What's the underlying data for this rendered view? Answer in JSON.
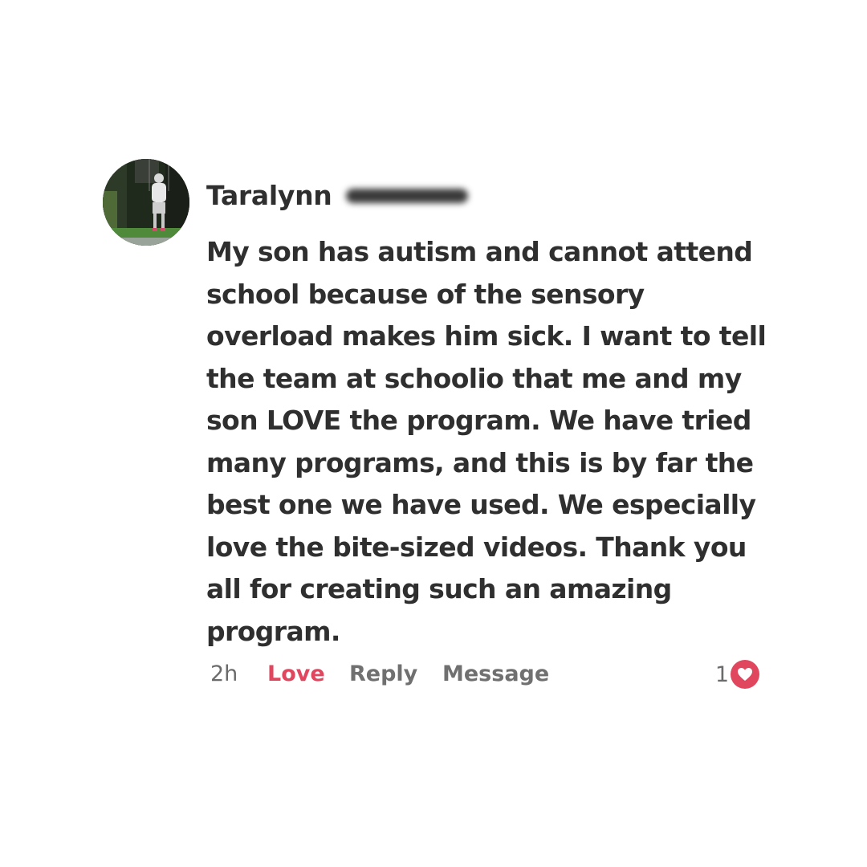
{
  "comment": {
    "author": {
      "name": "Taralynn",
      "avatar": "profile-photo-child-on-swing"
    },
    "text_lines": [
      "My son has autism and cannot attend",
      "school because of the sensory",
      "overload makes him sick. I want to tell",
      "the team at schoolio that me and my",
      "son LOVE the program. We have tried",
      "many programs, and this is by far the",
      "best one we have used. We especially",
      "love the bite-sized videos. Thank you",
      "all for creating such an amazing",
      "program."
    ],
    "actions": {
      "timestamp": "2h",
      "love_label": "Love",
      "reply_label": "Reply",
      "message_label": "Message"
    },
    "reactions": {
      "count": "1",
      "icon": "heart-icon"
    }
  },
  "colors": {
    "text": "#2f2f2f",
    "love_active": "#e0475f",
    "action_gray": "#707070",
    "background": "#ffffff"
  }
}
